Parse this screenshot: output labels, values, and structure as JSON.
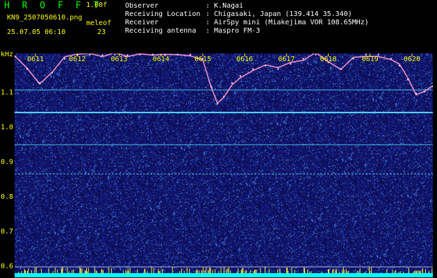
{
  "header": {
    "app_title": "H R O F F T",
    "version": "1.00f",
    "filename": "KN9_2507050610.png",
    "station": "meleof",
    "datetime": "25.07.05 06:10",
    "count": "23",
    "info": [
      {
        "label": "Observer",
        "value": ": K.Nagai"
      },
      {
        "label": "Receiving Location",
        "value": ": Chigasaki, Japan (139.414 35.340)"
      },
      {
        "label": "Receiver",
        "value": ": AirSpy mini (Miakejima VOR 108.65MHz)"
      },
      {
        "label": "Receiving antenna",
        "value": ": Maspro FM-3"
      }
    ]
  },
  "colors": {
    "title": "#00ff00",
    "info_text": "#ffffff",
    "axis_text": "#ffff00",
    "background": "#000000",
    "spectrum_bg": "#0d0d55",
    "carrier": "#55ddff",
    "floor": "#00ffff",
    "trace": "#ff99cc"
  },
  "chart_data": {
    "type": "heatmap",
    "ylabel": "kHz",
    "ylim": [
      0.57,
      1.215
    ],
    "y_ticks": [
      "1.1",
      "1.0",
      "0.9",
      "0.8",
      "0.7",
      "0.6"
    ],
    "x_ticks": [
      "0611",
      "0612",
      "0613",
      "0614",
      "0615",
      "0616",
      "0617",
      "0618",
      "0619",
      "0620"
    ],
    "x_range": [
      0,
      10
    ],
    "carrier_lines_khz": [
      1.11,
      1.045,
      0.952,
      0.868,
      0.6,
      0.58
    ],
    "trace": {
      "x": [
        0,
        0.3,
        0.6,
        0.9,
        1.2,
        1.5,
        1.8,
        2.1,
        2.4,
        2.7,
        3.0,
        3.3,
        3.6,
        3.9,
        4.2,
        4.5,
        4.7,
        4.85,
        5.0,
        5.2,
        5.4,
        5.7,
        6.0,
        6.3,
        6.6,
        6.9,
        7.2,
        7.5,
        7.8,
        8.1,
        8.4,
        8.7,
        9.0,
        9.2,
        9.4,
        9.6,
        9.8,
        10.0
      ],
      "y": [
        1.205,
        1.17,
        1.13,
        1.16,
        1.2,
        1.21,
        1.212,
        1.21,
        1.212,
        1.21,
        1.212,
        1.212,
        1.21,
        1.212,
        1.212,
        1.2,
        1.12,
        1.07,
        1.09,
        1.13,
        1.15,
        1.17,
        1.18,
        1.17,
        1.185,
        1.2,
        1.212,
        1.19,
        1.17,
        1.2,
        1.212,
        1.212,
        1.2,
        1.18,
        1.14,
        1.1,
        1.105,
        1.12
      ]
    }
  }
}
